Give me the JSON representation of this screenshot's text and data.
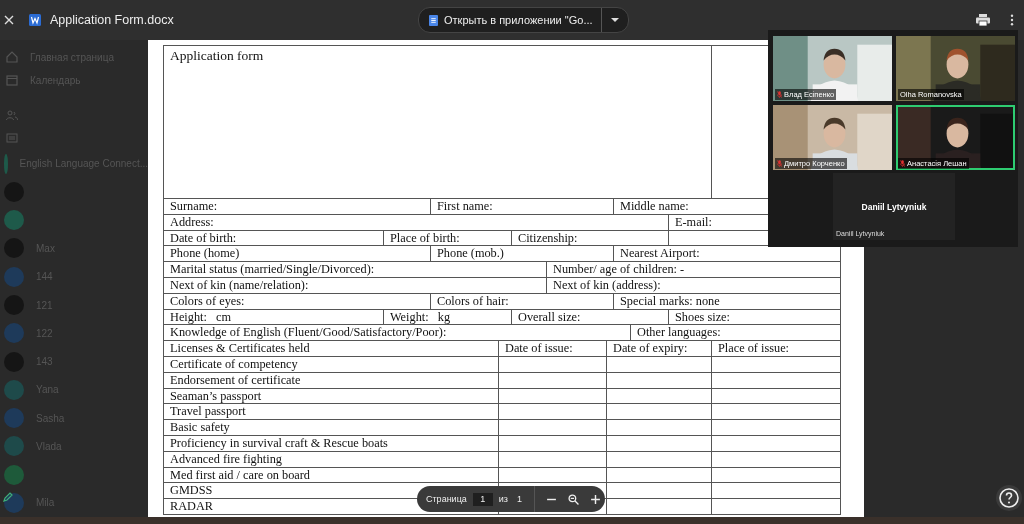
{
  "window": {
    "file_name": "Application Form.docx",
    "open_in_app": "Открыть в приложении \"Go..."
  },
  "sidebar": {
    "items": [
      {
        "kind": "icon",
        "label": "Главная страница"
      },
      {
        "kind": "icon",
        "label": "Календарь"
      },
      {
        "kind": "icon"
      },
      {
        "kind": "icon"
      },
      {
        "kind": "avatar",
        "color": "#1e5a4a",
        "label": "English Language Connect..."
      },
      {
        "kind": "avatar",
        "color": "#151515"
      },
      {
        "kind": "avatar",
        "color": "#1e5a4a"
      },
      {
        "kind": "avatar",
        "color": "#151515",
        "label": "Max"
      },
      {
        "kind": "avatar",
        "color": "#1e3a5a",
        "label": "144"
      },
      {
        "kind": "avatar",
        "color": "#151515",
        "label": "121"
      },
      {
        "kind": "avatar",
        "color": "#1e3a5a",
        "label": "122"
      },
      {
        "kind": "avatar",
        "color": "#151515",
        "label": "143"
      },
      {
        "kind": "avatar",
        "color": "#1e4a4a",
        "label": "Yana"
      },
      {
        "kind": "avatar",
        "color": "#1e3a5a",
        "label": "Sasha"
      },
      {
        "kind": "avatar",
        "color": "#1e4a4a",
        "label": "Vlada"
      },
      {
        "kind": "avatar",
        "color": "#1e5a3a"
      },
      {
        "kind": "avatar",
        "color": "#1e3a5a",
        "label": "Mila"
      }
    ]
  },
  "form": {
    "title": "Application form",
    "rows": [
      {
        "cells": [
          "Surname:",
          "First name:",
          "Middle name:"
        ]
      },
      {
        "cells": [
          "Address:",
          "E-mail:"
        ]
      },
      {
        "cells": [
          "Date of birth:",
          "Place of birth:",
          "Citizenship:"
        ]
      },
      {
        "cells": [
          "Phone (home)",
          "Phone (mob.)",
          "Nearest Airport:"
        ]
      },
      {
        "cells": [
          "Marital status (married/Single/Divorced):",
          "Number/ age of children: -"
        ]
      },
      {
        "cells": [
          "Next of kin (name/relation):",
          "Next of kin (address):"
        ]
      },
      {
        "cells": [
          "Colors of eyes:",
          "Colors of hair:",
          "Special marks: none"
        ]
      },
      {
        "cells": [
          "Height:   cm",
          "Weight:   kg",
          "Overall size:",
          "Shoes size:"
        ]
      },
      {
        "cells": [
          "Knowledge of English (Fluent/Good/Satisfactory/Poor):",
          "Other languages:"
        ]
      },
      {
        "cells": [
          "Licenses & Certificates held",
          "Date of issue:",
          "Date of expiry:",
          "Place of issue:"
        ]
      },
      {
        "cells": [
          "Certificate of competency"
        ]
      },
      {
        "cells": [
          "Endorsement of certificate"
        ]
      },
      {
        "cells": [
          "Seaman’s passport"
        ]
      },
      {
        "cells": [
          "Travel passport"
        ]
      },
      {
        "cells": [
          "Basic safety"
        ]
      },
      {
        "cells": [
          "Proficiency in survival craft & Rescue boats"
        ]
      },
      {
        "cells": [
          "Advanced fire fighting"
        ]
      },
      {
        "cells": [
          "Med first aid / care on board"
        ]
      },
      {
        "cells": [
          "GMDSS"
        ]
      },
      {
        "cells": [
          "RADAR"
        ]
      }
    ]
  },
  "page_toolbar": {
    "page_label": "Страница",
    "page": "1",
    "of_label": "из",
    "total": "1"
  },
  "call": {
    "participants": [
      {
        "name": "Влад Есіпенко",
        "muted": true,
        "speaking": false
      },
      {
        "name": "Olha Romanovska",
        "muted": false,
        "speaking": false
      },
      {
        "name": "Дмитро Корченко",
        "muted": true,
        "speaking": false
      },
      {
        "name": "Анастасія Лешан",
        "muted": true,
        "speaking": true
      }
    ],
    "no_video": {
      "display_name": "Daniil Lytvyniuk",
      "label": "Daniil Lytvyniuk"
    }
  }
}
